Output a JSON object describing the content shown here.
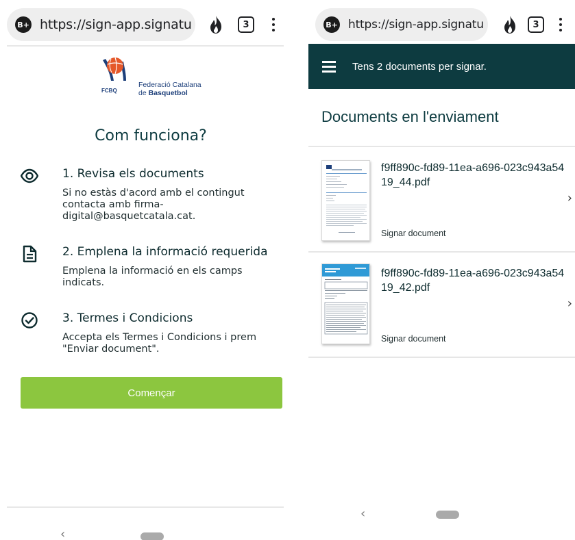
{
  "left": {
    "browser": {
      "url": "https://sign-app.signatu",
      "badge": "B+",
      "tab_count": "3"
    },
    "logo": {
      "abbr": "FCBQ",
      "name_line1": "Federació Catalana",
      "name_line2_prefix": "de",
      "name_line2_bold": "Basquetbol"
    },
    "title": "Com funciona?",
    "steps": [
      {
        "icon": "eye-icon",
        "title": "1. Revisa els documents",
        "desc": "Si no estàs d'acord amb el contingut contacta amb firma-digital@basquetcatala.cat."
      },
      {
        "icon": "document-icon",
        "title": "2. Emplena la informació requerida",
        "desc": "Emplena la informació en els camps indicats."
      },
      {
        "icon": "check-circle-icon",
        "title": "3. Termes i Condicions",
        "desc": "Accepta els Termes i Condicions i prem \"Enviar document\"."
      }
    ],
    "start_button": "Començar",
    "nav_back": "‹"
  },
  "right": {
    "browser": {
      "url": "https://sign-app.signatu",
      "badge": "B+",
      "tab_count": "3"
    },
    "header_text": "Tens 2 documents per signar.",
    "section_title": "Documents en l'enviament",
    "documents": [
      {
        "name": "f9ff890c-fd89-11ea-a696-023c943a5419_44.pdf",
        "action": "Signar document"
      },
      {
        "name": "f9ff890c-fd89-11ea-a696-023c943a5419_42.pdf",
        "action": "Signar document"
      }
    ],
    "chevron": "›",
    "nav_back": "‹"
  },
  "colors": {
    "primary": "#0d3b40",
    "accent_green": "#8cc63f",
    "logo_orange": "#e5582a",
    "logo_blue": "#1d3f7a"
  }
}
